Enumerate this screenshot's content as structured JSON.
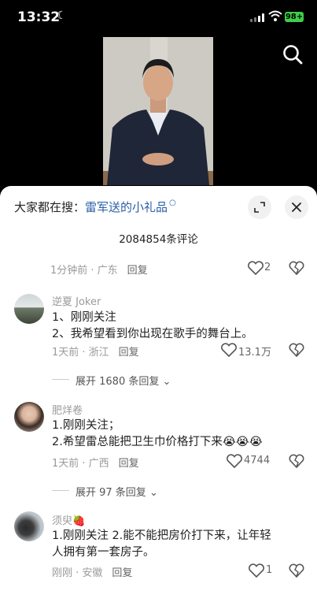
{
  "status_bar": {
    "time": "13:32",
    "battery": "98+"
  },
  "sheet": {
    "suggest_prefix": "大家都在搜：",
    "suggest_link": "雷军送的小礼品",
    "comment_count": "2084854条评论"
  },
  "partial_comment": {
    "time_loc": "1分钟前 · 广东",
    "reply": "回复",
    "likes": "2"
  },
  "comments": [
    {
      "user": "逆夏 Joker",
      "lines": [
        "1、刚刚关注",
        "2、我希望看到你出现在歌手的舞台上。"
      ],
      "time_loc": "1天前 · 浙江",
      "reply": "回复",
      "likes": "13.1万",
      "expand": "展开 1680 条回复"
    },
    {
      "user": "肥烊卷",
      "lines": [
        "1.刚刚关注；",
        "2.希望雷总能把卫生巾价格打下来😭😭😭"
      ],
      "time_loc": "1天前 · 广西",
      "reply": "回复",
      "likes": "4744",
      "expand": "展开 97 条回复"
    },
    {
      "user": "须臾🍓",
      "lines": [
        "1.刚刚关注  2.能不能把房价打下来，让年轻",
        "人拥有第一套房子。"
      ],
      "time_loc": "刚刚 · 安徽",
      "reply": "回复",
      "likes": "1"
    }
  ]
}
